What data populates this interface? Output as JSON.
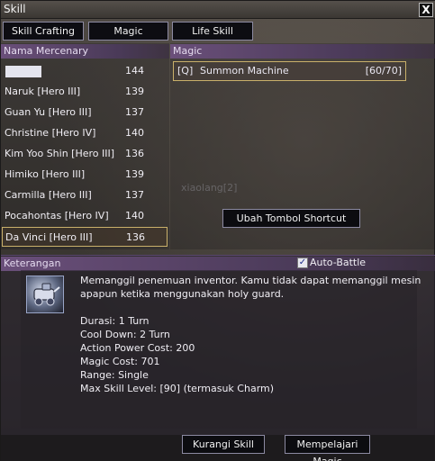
{
  "window": {
    "title": "Skill",
    "close_glyph": "X"
  },
  "tabs": [
    {
      "label": "Skill Crafting"
    },
    {
      "label": "Magic"
    },
    {
      "label": "Life Skill"
    }
  ],
  "mercenary_panel": {
    "header": "Nama Mercenary",
    "rows": [
      {
        "name": "",
        "level": "144"
      },
      {
        "name": "Naruk [Hero III]",
        "level": "139"
      },
      {
        "name": "Guan Yu [Hero III]",
        "level": "137"
      },
      {
        "name": "Christine [Hero IV]",
        "level": "140"
      },
      {
        "name": "Kim Yoo Shin [Hero III]",
        "level": "136"
      },
      {
        "name": "Himiko [Hero III]",
        "level": "139"
      },
      {
        "name": "Carmilla [Hero III]",
        "level": "137"
      },
      {
        "name": "Pocahontas [Hero IV]",
        "level": "140"
      },
      {
        "name": "Da Vinci [Hero III]",
        "level": "136"
      }
    ]
  },
  "magic_panel": {
    "header": "Magic",
    "item": {
      "key": "[Q]",
      "name": "Summon Machine",
      "count": "[60/70]"
    },
    "shortcut_button": "Ubah Tombol Shortcut",
    "watermark": "xiaolang[2]"
  },
  "description_panel": {
    "header": "Keterangan",
    "auto_battle_label": "Auto-Battle",
    "description_lines": [
      "Memanggil penemuan inventor. Kamu tidak dapat memanggil mesin",
      "apapun ketika menggunakan holy guard."
    ],
    "stats": [
      "Durasi: 1 Turn",
      "Cool Down: 2 Turn",
      "Action Power Cost: 200",
      "Magic Cost: 701",
      "Range: Single",
      "Max Skill Level: [90] (termasuk Charm)"
    ]
  },
  "footer": {
    "decrease_button": "Kurangi Skill",
    "learn_button": "Mempelajari Magic"
  }
}
